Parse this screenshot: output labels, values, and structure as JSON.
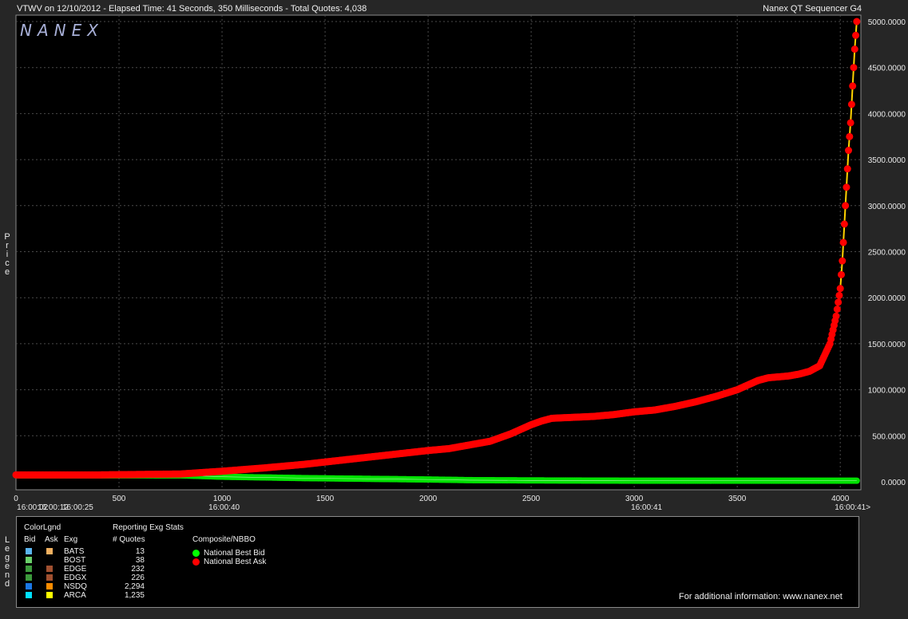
{
  "header": {
    "title": "VTWV on 12/10/2012  -  Elapsed Time: 41 Seconds, 350 Milliseconds  -  Total Quotes: 4,038",
    "brand_title": "Nanex QT Sequencer G4",
    "watermark": "NANEX"
  },
  "y_axis_title": "Price",
  "legend_side_title": "Legend",
  "chart_data": {
    "type": "line",
    "x_ticks": [
      0,
      500,
      1000,
      1500,
      2000,
      2500,
      3000,
      3500,
      4000
    ],
    "x_range": [
      0,
      4100
    ],
    "time_labels": [
      {
        "x": 80,
        "label": "16:00:02"
      },
      {
        "x": 180,
        "label": "16:00:12"
      },
      {
        "x": 300,
        "label": "16:00:25"
      },
      {
        "x": 1010,
        "label": "16:00:40"
      },
      {
        "x": 3060,
        "label": "16:00:41"
      },
      {
        "x": 4060,
        "label": "16:00:41>"
      }
    ],
    "y_ticks": [
      "5000.0000",
      "4500.0000",
      "4000.0000",
      "3500.0000",
      "3000.0000",
      "2500.0000",
      "2000.0000",
      "1500.0000",
      "1000.0000",
      "500.0000",
      "0.0000"
    ],
    "ylim": [
      0,
      5000
    ],
    "grid": true,
    "series": [
      {
        "name": "National Best Ask",
        "color": "#ff0000",
        "x": [
          0,
          400,
          800,
          1000,
          1200,
          1400,
          1600,
          1800,
          2000,
          2100,
          2200,
          2300,
          2400,
          2450,
          2500,
          2550,
          2600,
          2700,
          2800,
          2900,
          3000,
          3100,
          3200,
          3300,
          3400,
          3500,
          3550,
          3600,
          3650,
          3700,
          3750,
          3800,
          3850,
          3900,
          3950,
          3980,
          4000,
          4010,
          4020,
          4030,
          4040,
          4050,
          4060,
          4070,
          4080
        ],
        "y": [
          75,
          75,
          85,
          115,
          150,
          190,
          240,
          290,
          340,
          360,
          400,
          440,
          520,
          570,
          620,
          660,
          690,
          700,
          710,
          730,
          760,
          780,
          820,
          870,
          930,
          1000,
          1050,
          1100,
          1130,
          1140,
          1150,
          1170,
          1200,
          1260,
          1500,
          1800,
          2100,
          2400,
          2800,
          3200,
          3600,
          3900,
          4300,
          4700,
          5000
        ]
      },
      {
        "name": "National Best Bid",
        "color": "#00e000",
        "x": [
          0,
          800,
          1000,
          1400,
          2000,
          2200,
          2500,
          3000,
          3500,
          4000,
          4080
        ],
        "y": [
          70,
          70,
          55,
          40,
          25,
          18,
          15,
          12,
          12,
          12,
          12
        ]
      }
    ]
  },
  "legend": {
    "color_legend_title": "ColorLgnd",
    "stats_title": "Reporting Exg Stats",
    "col_bid": "Bid",
    "col_ask": "Ask",
    "col_exg": "Exg",
    "col_quotes": "# Quotes",
    "composite_title": "Composite/NBBO",
    "rows": [
      {
        "bid_color": "#5ab4f0",
        "ask_color": "#f0b060",
        "exg": "BATS",
        "quotes": "13"
      },
      {
        "bid_color": "#6ad06a",
        "ask_color": null,
        "exg": "BOST",
        "quotes": "38"
      },
      {
        "bid_color": "#3c9a3c",
        "ask_color": "#a05030",
        "exg": "EDGE",
        "quotes": "232"
      },
      {
        "bid_color": "#3c9a3c",
        "ask_color": "#a05030",
        "exg": "EDGX",
        "quotes": "226"
      },
      {
        "bid_color": "#1a78e6",
        "ask_color": "#ff8c00",
        "exg": "NSDQ",
        "quotes": "2,294"
      },
      {
        "bid_color": "#00e0ff",
        "ask_color": "#ffff00",
        "exg": "ARCA",
        "quotes": "1,235"
      }
    ],
    "nbbo": [
      {
        "color": "#00ff00",
        "label": "National Best Bid"
      },
      {
        "color": "#ff0000",
        "label": "National Best Ask"
      }
    ],
    "info": "For additional information: www.nanex.net"
  }
}
